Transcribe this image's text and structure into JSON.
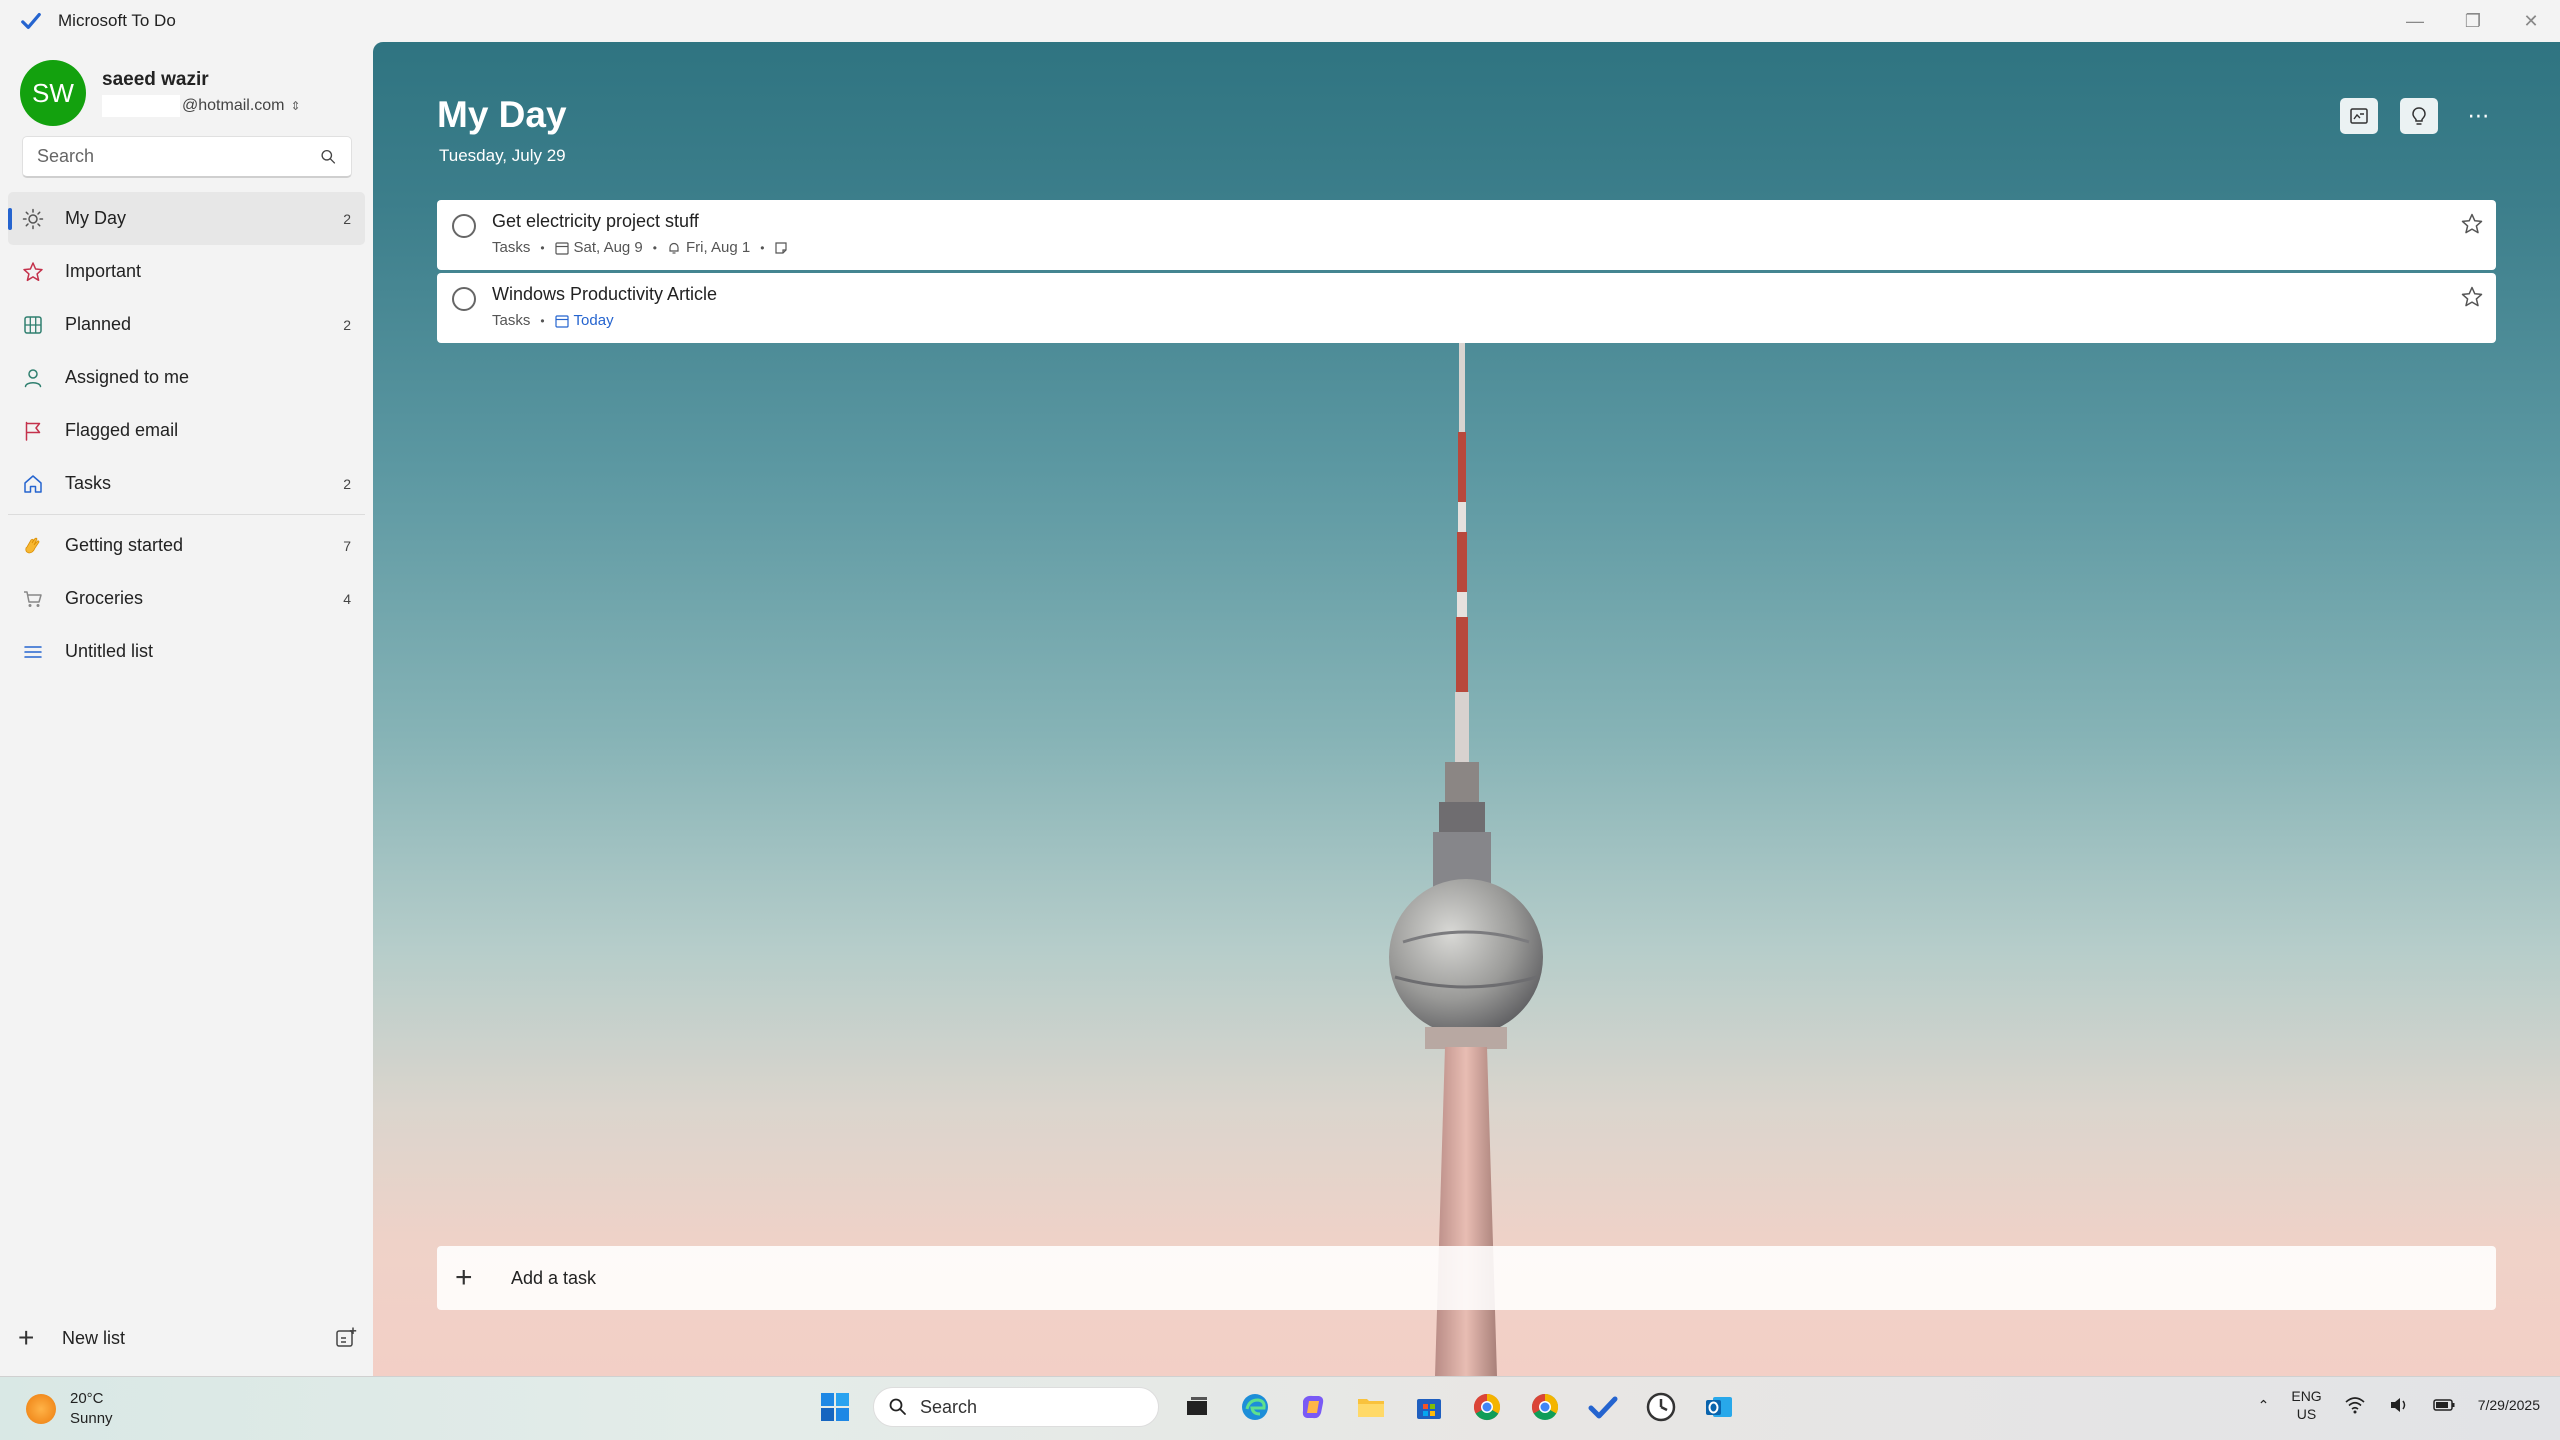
{
  "app": {
    "title": "Microsoft To Do",
    "accent": "#2564cf"
  },
  "account": {
    "initials": "SW",
    "name": "saeed wazir",
    "email": "@hotmail.com",
    "avatar_color": "#13a10e"
  },
  "search": {
    "placeholder": "Search"
  },
  "sidebar": {
    "items": [
      {
        "label": "My Day",
        "count": "2",
        "icon": "sun-icon",
        "active": true
      },
      {
        "label": "Important",
        "count": "",
        "icon": "star-icon"
      },
      {
        "label": "Planned",
        "count": "2",
        "icon": "calendar-grid-icon"
      },
      {
        "label": "Assigned to me",
        "count": "",
        "icon": "person-icon"
      },
      {
        "label": "Flagged email",
        "count": "",
        "icon": "flag-icon"
      },
      {
        "label": "Tasks",
        "count": "2",
        "icon": "home-icon"
      }
    ],
    "lists": [
      {
        "label": "Getting started",
        "count": "7",
        "icon": "wave-hand-icon"
      },
      {
        "label": "Groceries",
        "count": "4",
        "icon": "cart-icon"
      },
      {
        "label": "Untitled list",
        "count": "",
        "icon": "list-lines-icon"
      }
    ],
    "new_list_label": "New list"
  },
  "main": {
    "title": "My Day",
    "date": "Tuesday, July 29",
    "tasks": [
      {
        "title": "Get electricity project stuff",
        "list": "Tasks",
        "due": "Sat, Aug 9",
        "reminder": "Fri, Aug 1",
        "has_note": true
      },
      {
        "title": "Windows Productivity Article",
        "list": "Tasks",
        "due": "Today"
      }
    ],
    "add_task_label": "Add a task"
  },
  "taskbar": {
    "weather_temp": "20°C",
    "weather_desc": "Sunny",
    "search_label": "Search",
    "lang_top": "ENG",
    "lang_bottom": "US",
    "date": "7/29/2025"
  }
}
